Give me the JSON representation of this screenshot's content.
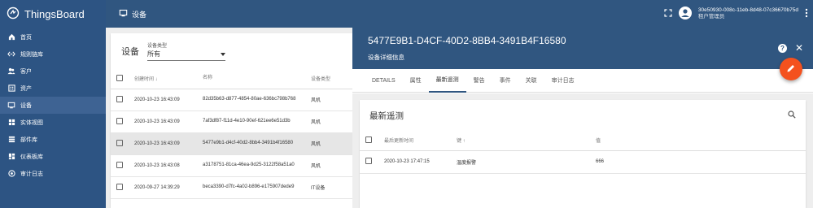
{
  "app": {
    "logo_text": "ThingsBoard"
  },
  "sidebar": {
    "items": [
      {
        "label": "首页",
        "icon": "home-icon"
      },
      {
        "label": "规则链库",
        "icon": "rule-chain-icon"
      },
      {
        "label": "客户",
        "icon": "customers-icon"
      },
      {
        "label": "资产",
        "icon": "assets-icon"
      },
      {
        "label": "设备",
        "icon": "devices-icon",
        "active": true
      },
      {
        "label": "实体视图",
        "icon": "entity-view-icon"
      },
      {
        "label": "部件库",
        "icon": "widgets-icon"
      },
      {
        "label": "仪表板库",
        "icon": "dashboards-icon"
      },
      {
        "label": "审计日志",
        "icon": "audit-log-icon"
      }
    ]
  },
  "topbar": {
    "title": "设备",
    "user_id": "30e50930-008c-11eb-8d48-07c36670b75d",
    "user_role": "租户管理员"
  },
  "device_list": {
    "title": "设备",
    "filter_label": "设备类型",
    "filter_value": "所有",
    "columns": {
      "created": "创建时间 ↓",
      "name": "名称",
      "type": "设备类型"
    },
    "rows": [
      {
        "created": "2020-10-23 16:43:09",
        "name": "82d35b63-d877-4854-80ae-636bc798b768",
        "type": "风机"
      },
      {
        "created": "2020-10-23 16:43:09",
        "name": "7af3df87-f11d-4e10-90ef-621ee6e51d3b",
        "type": "风机"
      },
      {
        "created": "2020-10-23 16:43:09",
        "name": "5477e9b1-d4cf-40d2-8bb4-3491b4f16580",
        "type": "风机",
        "selected": true
      },
      {
        "created": "2020-10-23 16:43:08",
        "name": "a3178751-81ca-46ea-9d25-3122f58a51a0",
        "type": "风机"
      },
      {
        "created": "2020-09-27 14:39:29",
        "name": "beca3390-d7fc-4a02-b896-e175907dede9",
        "type": "IT设备"
      }
    ]
  },
  "detail": {
    "title": "5477E9B1-D4CF-40D2-8BB4-3491B4F16580",
    "subtitle": "设备详细信息",
    "help_label": "?",
    "close_label": "✕",
    "tabs": [
      {
        "label": "DETAILS"
      },
      {
        "label": "属性"
      },
      {
        "label": "最新遥测",
        "active": true
      },
      {
        "label": "警告"
      },
      {
        "label": "事件"
      },
      {
        "label": "关联"
      },
      {
        "label": "审计日志"
      }
    ],
    "telemetry": {
      "title": "最新遥测",
      "columns": {
        "updated": "最后更新时间",
        "key": "键 ↑",
        "value": "值"
      },
      "rows": [
        {
          "updated": "2020-10-23 17:47:15",
          "key": "温度报警",
          "value": "666"
        }
      ]
    }
  },
  "colors": {
    "primary": "#305680",
    "sidebar": "#2d5483",
    "accent": "#f4511e"
  }
}
